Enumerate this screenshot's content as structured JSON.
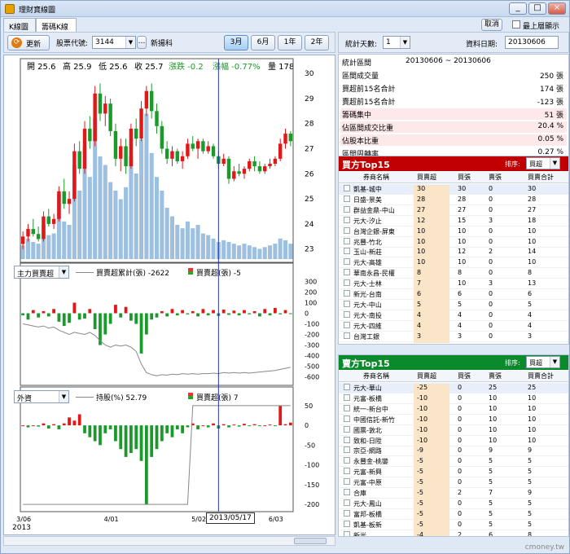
{
  "window": {
    "title": "理財寶線圖",
    "btn_min": "_",
    "btn_max": "□",
    "btn_close": "×"
  },
  "tabs": [
    {
      "label": "K線圖"
    },
    {
      "label": "籌碼K線圖"
    }
  ],
  "toolbar": {
    "refresh_label": "更新",
    "stock_code_label": "股票代號:",
    "stock_code": "3144",
    "more": "…",
    "stock_name": "新揚科",
    "range_buttons": [
      "3月",
      "6月",
      "1年",
      "2年"
    ],
    "selected_range": "3月"
  },
  "ohlc": {
    "open": "開 25.6",
    "high": "高 25.9",
    "low": "低 25.6",
    "close": "收 25.7",
    "change": "漲跌 -0.2",
    "pct": "漲幅 -0.77%",
    "volume": "量 178"
  },
  "top_right": {
    "restore_btn": "取消",
    "always_on_top": "最上層顯示"
  },
  "chart_data": {
    "type": "candlestick",
    "price_ticks": [
      "30",
      "29",
      "28",
      "27",
      "26",
      "25",
      "24",
      "23"
    ],
    "price_range": [
      22.6,
      30.2
    ],
    "x_ticks": [
      "3/06",
      "4/01",
      "5/02",
      "6/03"
    ],
    "x_year": "2013",
    "cursor_date": "2013/05/17",
    "candles": [
      [
        23.2,
        23.7,
        23.0,
        23.5
      ],
      [
        23.5,
        24.0,
        23.3,
        23.8
      ],
      [
        23.8,
        24.2,
        23.5,
        23.6
      ],
      [
        23.6,
        23.9,
        23.3,
        23.4
      ],
      [
        23.4,
        24.5,
        23.3,
        24.3
      ],
      [
        24.3,
        24.6,
        23.9,
        24.0
      ],
      [
        24.0,
        24.4,
        23.8,
        24.2
      ],
      [
        24.2,
        25.5,
        24.1,
        25.3
      ],
      [
        25.3,
        25.8,
        24.6,
        24.8
      ],
      [
        24.8,
        25.3,
        24.4,
        25.0
      ],
      [
        25.0,
        27.2,
        24.9,
        26.9
      ],
      [
        26.9,
        27.3,
        26.0,
        26.2
      ],
      [
        26.2,
        28.1,
        26.0,
        27.8
      ],
      [
        27.8,
        28.3,
        27.0,
        27.3
      ],
      [
        27.3,
        29.5,
        27.1,
        29.2
      ],
      [
        29.2,
        29.6,
        28.1,
        28.4
      ],
      [
        28.4,
        29.1,
        27.9,
        28.8
      ],
      [
        28.8,
        29.0,
        27.5,
        27.7
      ],
      [
        27.7,
        28.0,
        26.3,
        26.6
      ],
      [
        26.6,
        27.4,
        26.1,
        27.1
      ],
      [
        27.1,
        27.4,
        26.0,
        26.3
      ],
      [
        26.3,
        28.0,
        26.2,
        27.8
      ],
      [
        27.8,
        28.2,
        27.1,
        27.4
      ],
      [
        27.4,
        28.9,
        27.3,
        28.6
      ],
      [
        28.6,
        29.5,
        28.3,
        29.3
      ],
      [
        29.3,
        29.6,
        28.2,
        28.5
      ],
      [
        28.5,
        28.8,
        27.6,
        27.9
      ],
      [
        27.9,
        28.1,
        26.8,
        27.0
      ],
      [
        27.0,
        27.3,
        26.4,
        26.6
      ],
      [
        26.6,
        27.1,
        26.3,
        26.9
      ],
      [
        26.9,
        27.0,
        26.4,
        26.5
      ],
      [
        26.5,
        26.9,
        26.2,
        26.7
      ],
      [
        26.7,
        27.4,
        26.6,
        27.2
      ],
      [
        27.2,
        27.5,
        26.9,
        27.0
      ],
      [
        27.0,
        27.4,
        26.6,
        27.3
      ],
      [
        27.3,
        27.4,
        26.8,
        26.9
      ],
      [
        26.9,
        27.3,
        26.8,
        27.1
      ],
      [
        27.1,
        27.2,
        26.6,
        26.7
      ],
      [
        26.7,
        26.9,
        26.2,
        26.4
      ],
      [
        26.4,
        26.8,
        26.3,
        26.6
      ],
      [
        26.6,
        26.7,
        25.6,
        25.8
      ],
      [
        25.8,
        26.3,
        25.7,
        26.1
      ],
      [
        26.1,
        26.4,
        25.9,
        26.0
      ],
      [
        26.0,
        26.3,
        25.8,
        26.2
      ],
      [
        26.2,
        26.6,
        26.1,
        26.5
      ],
      [
        26.5,
        26.7,
        26.1,
        26.3
      ],
      [
        26.3,
        26.5,
        26.0,
        26.1
      ],
      [
        26.1,
        26.4,
        26.0,
        26.3
      ],
      [
        26.3,
        26.6,
        26.2,
        26.4
      ],
      [
        26.4,
        26.7,
        26.3,
        26.6
      ],
      [
        26.6,
        27.4,
        26.5,
        27.2
      ],
      [
        27.2,
        27.8,
        27.0,
        27.6
      ],
      [
        27.6,
        27.7,
        27.1,
        27.3
      ]
    ],
    "volume_levels": [
      0.08,
      0.12,
      0.1,
      0.09,
      0.2,
      0.14,
      0.15,
      0.38,
      0.22,
      0.2,
      0.55,
      0.4,
      0.66,
      0.48,
      0.82,
      0.6,
      0.55,
      0.45,
      0.4,
      0.35,
      0.42,
      0.6,
      0.5,
      0.7,
      0.85,
      0.62,
      0.48,
      0.4,
      0.3,
      0.25,
      0.2,
      0.18,
      0.22,
      0.18,
      0.2,
      0.15,
      0.14,
      0.12,
      0.1,
      0.11,
      0.1,
      0.09,
      0.08,
      0.09,
      0.08,
      0.07,
      0.06,
      0.07,
      0.08,
      0.09,
      0.12,
      0.11,
      0.09
    ],
    "panel2": {
      "selector": "主力買賣超",
      "legend_line": "買賣超累計(張) -2622",
      "legend_bar": "買賣超(張) -5",
      "ticks": [
        "300",
        "200",
        "100",
        "0",
        "-100",
        "-200",
        "-300",
        "-400",
        "-500",
        "-600"
      ],
      "range": [
        -650,
        350
      ],
      "bars": [
        -20,
        -60,
        30,
        -40,
        20,
        -30,
        40,
        -80,
        -120,
        -90,
        100,
        -60,
        -50,
        40,
        -150,
        -300,
        -200,
        -100,
        80,
        -40,
        60,
        -70,
        -100,
        -380,
        -200,
        -60,
        -40,
        20,
        -30,
        40,
        -20,
        30,
        -10,
        20,
        -30,
        40,
        -20,
        30,
        -25,
        35,
        -15,
        25,
        -20,
        30,
        -10,
        20,
        -30,
        40,
        -20,
        50,
        -10,
        30,
        -5
      ],
      "cumulative": [
        -100,
        -110,
        -120,
        -130,
        -120,
        -140,
        -130,
        -160,
        -180,
        -200,
        -180,
        -190,
        -200,
        -180,
        -210,
        -260,
        -300,
        -320,
        -300,
        -310,
        -300,
        -320,
        -360,
        -480,
        -560,
        -580,
        -590,
        -580,
        -585,
        -575,
        -580,
        -570,
        -575,
        -570,
        -575,
        -570,
        -570,
        -565,
        -570,
        -560,
        -565,
        -560,
        -565,
        -560,
        -565,
        -560,
        -555,
        -550,
        -545,
        -540,
        -530,
        -520,
        -510
      ]
    },
    "panel3": {
      "selector": "外資",
      "legend_line": "持股(%) 52.79",
      "legend_bar": "買賣超(張) 7",
      "ticks": [
        "50",
        "0",
        "-50",
        "-100",
        "-150",
        "-200"
      ],
      "range": [
        -210,
        60
      ],
      "bars": [
        0,
        -5,
        0,
        -3,
        5,
        -8,
        3,
        -10,
        5,
        20,
        12,
        28,
        -20,
        -30,
        -40,
        -50,
        -20,
        -10,
        -40,
        -60,
        -80,
        -70,
        -60,
        -90,
        -200,
        -80,
        -60,
        -40,
        -20,
        -30,
        -10,
        -20,
        -5,
        5,
        -10,
        0,
        -5,
        5,
        -8,
        3,
        -5,
        2,
        -3,
        4,
        -2,
        3,
        -1,
        0,
        2,
        -2,
        50,
        3,
        7
      ],
      "holding": [
        -200,
        -200,
        -200,
        -200,
        -200,
        -200,
        -200,
        -200,
        -200,
        -200,
        -200,
        -200,
        -200,
        -200,
        -200,
        -200,
        -200,
        -200,
        -200,
        -200,
        -200,
        -200,
        -200,
        -200,
        -200,
        -200,
        -200,
        -200,
        -200,
        -200,
        -200,
        -200,
        -200,
        50,
        50,
        50,
        50,
        50,
        50,
        50,
        50,
        50,
        50,
        50,
        50,
        50,
        50,
        50,
        50,
        50,
        50,
        50,
        50
      ]
    }
  },
  "right": {
    "stat_days_label": "統計天數:",
    "stat_days": "1",
    "data_date_label": "資料日期:",
    "data_date": "20130606",
    "stats": [
      {
        "k": "統計區間",
        "v": "20130606 ~ 20130606",
        "mid": true
      },
      {
        "k": "區間成交量",
        "v": "250 張"
      },
      {
        "k": "買超前15名合計",
        "v": "174 張"
      },
      {
        "k": "賣超前15名合計",
        "v": "-123 張"
      },
      {
        "k": "籌碼集中",
        "v": "51 張",
        "pink": true
      },
      {
        "k": "佔區間成交比重",
        "v": "20.4 %",
        "pink": true
      },
      {
        "k": "佔股本比重",
        "v": "0.05 %",
        "pink": true
      },
      {
        "k": "區間周轉率",
        "v": "0.27 %"
      }
    ],
    "buy": {
      "title": "買方Top15",
      "sort_label": "排序:",
      "sort_value": "買超",
      "color": "#c00000",
      "cols": [
        "券商名稱",
        "買賣超",
        "買張",
        "賣張",
        "買賣合計"
      ],
      "rows": [
        [
          "凱基-城中",
          "30",
          "30",
          "0",
          "30"
        ],
        [
          "日盛-景美",
          "28",
          "28",
          "0",
          "28"
        ],
        [
          "群益金鼎-中山",
          "27",
          "27",
          "0",
          "27"
        ],
        [
          "元大-汐止",
          "12",
          "15",
          "3",
          "18"
        ],
        [
          "台灣企銀-屏東",
          "10",
          "10",
          "0",
          "10"
        ],
        [
          "兆豐-竹北",
          "10",
          "10",
          "0",
          "10"
        ],
        [
          "玉山-新莊",
          "10",
          "12",
          "2",
          "14"
        ],
        [
          "元大-高雄",
          "10",
          "10",
          "0",
          "10"
        ],
        [
          "華南永昌-民權",
          "8",
          "8",
          "0",
          "8"
        ],
        [
          "元大-士林",
          "7",
          "10",
          "3",
          "13"
        ],
        [
          "新光-台南",
          "6",
          "6",
          "0",
          "6"
        ],
        [
          "元大-中山",
          "5",
          "5",
          "0",
          "5"
        ],
        [
          "元大-南投",
          "4",
          "4",
          "0",
          "4"
        ],
        [
          "元大-四維",
          "4",
          "4",
          "0",
          "4"
        ],
        [
          "台灣工銀",
          "3",
          "3",
          "0",
          "3"
        ]
      ]
    },
    "sell": {
      "title": "賣方Top15",
      "sort_label": "排序:",
      "sort_value": "買超",
      "color": "#0a8a2a",
      "cols": [
        "券商名稱",
        "買賣超",
        "買張",
        "賣張",
        "買賣合計"
      ],
      "rows": [
        [
          "元大-華山",
          "-25",
          "0",
          "25",
          "25"
        ],
        [
          "元富-板橋",
          "-10",
          "0",
          "10",
          "10"
        ],
        [
          "統一-新台中",
          "-10",
          "0",
          "10",
          "10"
        ],
        [
          "中國信託-新竹",
          "-10",
          "0",
          "10",
          "10"
        ],
        [
          "國票-敦北",
          "-10",
          "0",
          "10",
          "10"
        ],
        [
          "致和-日陞",
          "-10",
          "0",
          "10",
          "10"
        ],
        [
          "宗亞-網路",
          "-9",
          "0",
          "9",
          "9"
        ],
        [
          "永豐金-桃鑾",
          "-5",
          "0",
          "5",
          "5"
        ],
        [
          "元富-新興",
          "-5",
          "0",
          "5",
          "5"
        ],
        [
          "元富-中原",
          "-5",
          "0",
          "5",
          "5"
        ],
        [
          "合庫",
          "-5",
          "2",
          "7",
          "9"
        ],
        [
          "元大-鳳山",
          "-5",
          "0",
          "5",
          "5"
        ],
        [
          "富邦-板橋",
          "-5",
          "0",
          "5",
          "5"
        ],
        [
          "凱基-板新",
          "-5",
          "0",
          "5",
          "5"
        ],
        [
          "新光",
          "-4",
          "2",
          "6",
          "8"
        ]
      ]
    }
  },
  "footer": "cmoney.tw"
}
